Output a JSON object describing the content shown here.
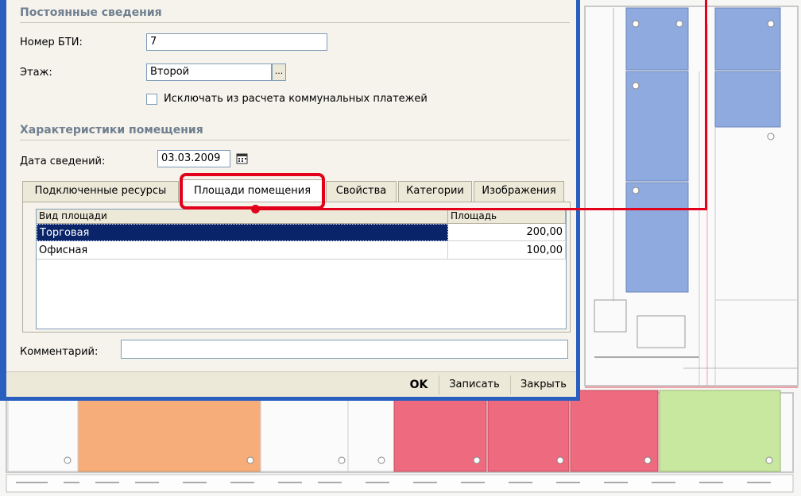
{
  "section_permanent": {
    "title": "Постоянные сведения"
  },
  "bti": {
    "label": "Номер БТИ:",
    "value": "7"
  },
  "floor": {
    "label": "Этаж:",
    "value": "Второй",
    "button": "..."
  },
  "exclude": {
    "label": "Исключать из расчета коммунальных платежей",
    "checked": false
  },
  "section_characteristics": {
    "title": "Характеристики помещения"
  },
  "info_date": {
    "label": "Дата сведений:",
    "value": "03.03.2009"
  },
  "tabs": [
    {
      "label": "Подключенные ресурсы"
    },
    {
      "label": "Площади помещения",
      "active": true
    },
    {
      "label": "Свойства"
    },
    {
      "label": "Категории"
    },
    {
      "label": "Изображения"
    }
  ],
  "grid": {
    "columns": [
      "Вид площади",
      "Площадь"
    ],
    "rows": [
      {
        "type": "Торговая",
        "area": "200,00",
        "selected": true
      },
      {
        "type": "Офисная",
        "area": "100,00",
        "selected": false
      }
    ]
  },
  "comment": {
    "label": "Комментарий:",
    "value": ""
  },
  "buttons": {
    "ok": "OK",
    "save": "Записать",
    "close": "Закрыть"
  },
  "colors": {
    "dialog_frame": "#2a5fbf",
    "highlight": "#e2001a",
    "selection": "#0a246a",
    "room_blue": "#8eaadf",
    "room_orange": "#f6ad7a",
    "room_pink": "#ee6a7e",
    "room_green": "#c8e8a0"
  }
}
